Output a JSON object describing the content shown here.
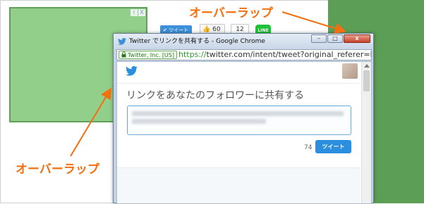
{
  "annotations": {
    "top_label": "オーバーラップ",
    "bottom_label": "オーバーラップ",
    "color": "#f2700f"
  },
  "ad": {
    "badge_i": "i",
    "badge_x": "X",
    "color": "#92cf8a"
  },
  "share_bar": {
    "tweet_label": "ツイート",
    "like_count": "60",
    "share_count": "12",
    "line_label": "LINE"
  },
  "popup": {
    "window_title": "Twitter でリンクを共有する - Google Chrome",
    "minimize_glyph": "–",
    "maximize_glyph": "□",
    "close_glyph": "x",
    "security_label": "Twitter, Inc. [US]",
    "url_scheme": "https://",
    "url_rest": "twitter.com/intent/tweet?original_referer=h",
    "heading": "リンクをあなたのフォロワーに共有する",
    "char_count": "74",
    "submit_label": "ツイート"
  },
  "colors": {
    "right_column": "#5d9e56",
    "twitter_blue": "#2b8ede"
  }
}
